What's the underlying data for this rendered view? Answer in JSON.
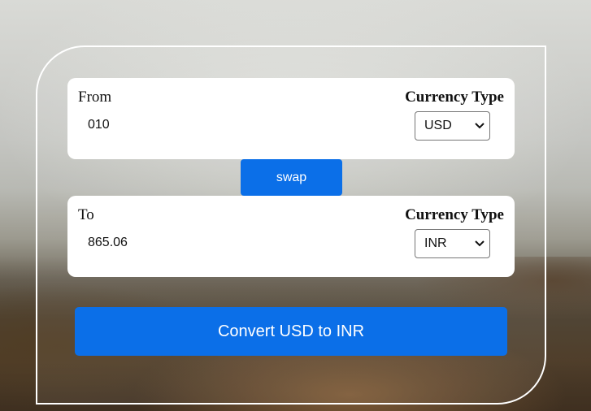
{
  "from": {
    "label": "From",
    "amount": "010",
    "currency_type_label": "Currency Type",
    "currency": "USD"
  },
  "swap": {
    "label": "swap"
  },
  "to": {
    "label": "To",
    "amount": "865.06",
    "currency_type_label": "Currency Type",
    "currency": "INR"
  },
  "convert": {
    "label": "Convert USD to INR"
  },
  "colors": {
    "button": "#0b6fe8",
    "card": "#ffffff",
    "frame_border": "#ffffff"
  },
  "icons": {
    "select_arrow": "chevron-down-icon"
  }
}
